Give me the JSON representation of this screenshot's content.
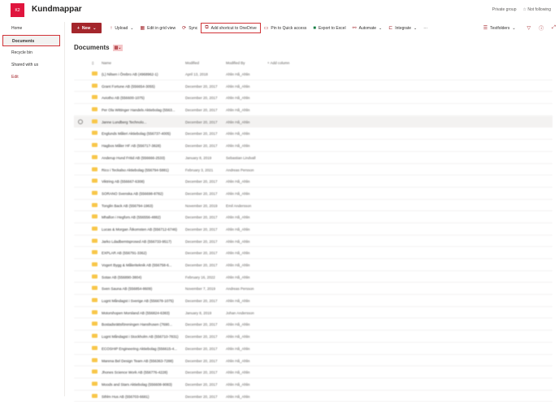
{
  "site": {
    "logo_text": "K2",
    "title": "Kundmappar",
    "privacy": "Private group",
    "follow": "Not following"
  },
  "sidebar": {
    "items": [
      {
        "label": "Home"
      },
      {
        "label": "Documents"
      },
      {
        "label": "Recycle bin"
      },
      {
        "label": "Shared with us"
      },
      {
        "label": "Edit"
      }
    ]
  },
  "toolbar": {
    "new": "New",
    "upload": "Upload",
    "grid": "Edit in grid view",
    "sync": "Sync",
    "shortcut": "Add shortcut to OneDrive",
    "pin": "Pin to Quick access",
    "export": "Export to Excel",
    "automate": "Automate",
    "integrate": "Integrate",
    "more": "···",
    "view": "Testfolders"
  },
  "library": {
    "title": "Documents"
  },
  "columns": {
    "name": "Name",
    "modified": "Modified",
    "modified_by": "Modified By",
    "add": "+ Add column"
  },
  "rows": [
    {
      "name": "(L) Nilsen i Örebro AB (4968962-1)",
      "modified": "April 13, 2018",
      "by": "Ahlin Hå_Ahlin"
    },
    {
      "name": "Grant Fortune AB (556654-3055)",
      "modified": "December 20, 2017",
      "by": "Ahlin Hå_Ahlin"
    },
    {
      "name": "Aviotho AB (556600-1075)",
      "modified": "December 20, 2017",
      "by": "Ahlin Hå_Ahlin"
    },
    {
      "name": "Per Ola Wittinger Handels Aktiebolag (5563...",
      "modified": "December 20, 2017",
      "by": "Ahlin Hå_Ahlin"
    },
    {
      "name": "Janne Lundberg Technolo...",
      "modified": "December 20, 2017",
      "by": "Ahlin Hå_Ahlin"
    },
    {
      "name": "Englunds Måleri Aktiebolag (556737-4005)",
      "modified": "December 20, 2017",
      "by": "Ahlin Hå_Ahlin"
    },
    {
      "name": "Hagbos Måler HF AB (556717-3828)",
      "modified": "December 20, 2017",
      "by": "Ahlin Hå_Ahlin"
    },
    {
      "name": "Anderup Hund Fritid AB (556666-2533)",
      "modified": "January 8, 2019",
      "by": "Sebastian Lindvall"
    },
    {
      "name": "Rico i Teckalso Aktiebolag (556794-5881)",
      "modified": "February 3, 2021",
      "by": "Andreas Persson"
    },
    {
      "name": "Viktring AB (556667-6308)",
      "modified": "December 20, 2017",
      "by": "Ahlin Hå_Ahlin"
    },
    {
      "name": "SORANO Svenska AB (556698-8782)",
      "modified": "December 20, 2017",
      "by": "Ahlin Hå_Ahlin"
    },
    {
      "name": "Tonglin Back AB (556794-1963)",
      "modified": "November 20, 2019",
      "by": "Emil Andersson"
    },
    {
      "name": "Mhallon i Hegfors AB (556556-4882)",
      "modified": "December 20, 2017",
      "by": "Ahlin Hå_Ahlin"
    },
    {
      "name": "Lucas & Morgan Åtkomsten AB (556712-6746)",
      "modified": "December 20, 2017",
      "by": "Ahlin Hå_Ahlin"
    },
    {
      "name": "Jarko Ldadbemtsprosed AB (556733-9517)",
      "modified": "December 20, 2017",
      "by": "Ahlin Hå_Ahlin"
    },
    {
      "name": "EXPLAR AB (556791-3362)",
      "modified": "December 20, 2017",
      "by": "Ahlin Hå_Ahlin"
    },
    {
      "name": "Vogert Bygg & Måleriteknik AB (556758-6...",
      "modified": "December 20, 2017",
      "by": "Ahlin Hå_Ahlin"
    },
    {
      "name": "Sotax AB (556890-3804)",
      "modified": "February 16, 2022",
      "by": "Ahlin Hå_Ahlin"
    },
    {
      "name": "Sven Sauna AB (556854-8609)",
      "modified": "November 7, 2019",
      "by": "Andreas Persson"
    },
    {
      "name": "Lugnt Måndagst i Sverige AB (556678-1075)",
      "modified": "December 20, 2017",
      "by": "Ahlin Hå_Ahlin"
    },
    {
      "name": "Motorshopen Morsland AB (556824-6383)",
      "modified": "January 8, 2019",
      "by": "Johan Andersson"
    },
    {
      "name": "Bostadsrättsföreningen Hansfrusen (7690...",
      "modified": "December 20, 2017",
      "by": "Ahlin Hå_Ahlin"
    },
    {
      "name": "Lugnt Måndagst i Stockholm AB (556710-7831)",
      "modified": "December 20, 2017",
      "by": "Ahlin Hå_Ahlin"
    },
    {
      "name": "ECOSHIP Engineering Aktiebolag (556615-4...",
      "modified": "December 20, 2017",
      "by": "Ahlin Hå_Ahlin"
    },
    {
      "name": "Marena Bel Design Team AB (556363-7288)",
      "modified": "December 20, 2017",
      "by": "Ahlin Hå_Ahlin"
    },
    {
      "name": "Jhones Science Work AB (556776-4228)",
      "modified": "December 20, 2017",
      "by": "Ahlin Hå_Ahlin"
    },
    {
      "name": "Moods and Stars Aktiebolag (556608-9083)",
      "modified": "December 20, 2017",
      "by": "Ahlin Hå_Ahlin"
    },
    {
      "name": "Sthlm Hus AB (556703-6681)",
      "modified": "December 20, 2017",
      "by": "Ahlin Hå_Ahlin"
    }
  ]
}
